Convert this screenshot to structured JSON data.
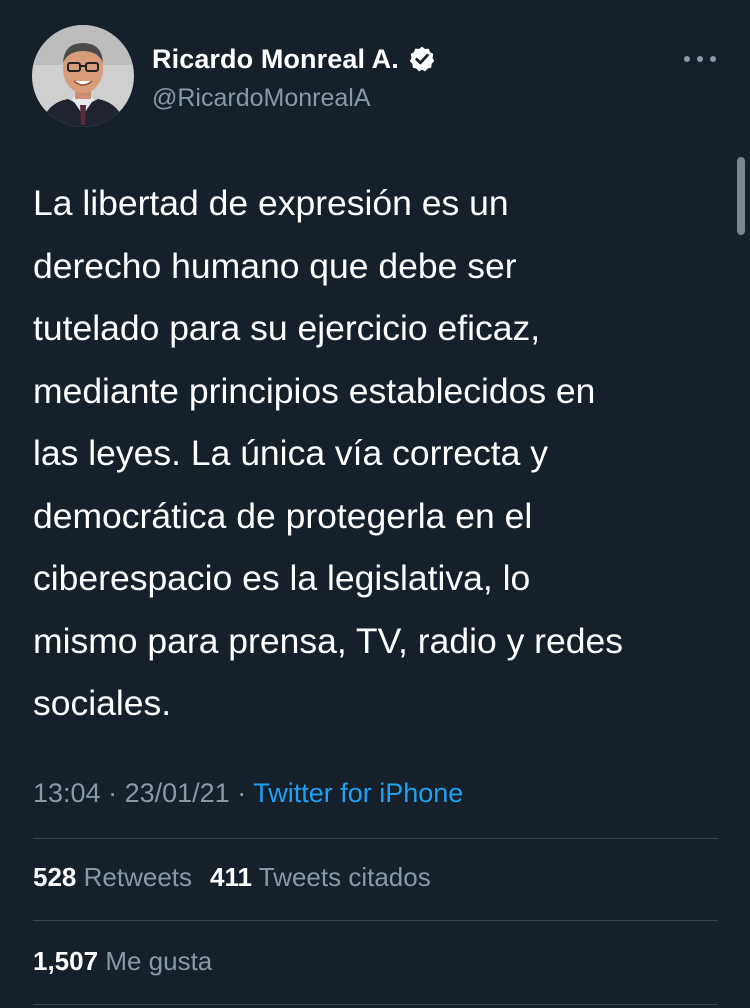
{
  "user": {
    "display_name": "Ricardo Monreal A.",
    "handle": "@RicardoMonrealA",
    "verified": true,
    "avatar_icon": "profile-photo"
  },
  "tweet": {
    "text": "La libertad de expresión es un\nderecho humano que debe ser\ntutelado para su ejercicio eficaz,\nmediante principios establecidos en\nlas leyes. La única vía correcta y\ndemocrática de protegerla en el\nciberespacio es la legislativa, lo\nmismo para prensa, TV, radio y redes\nsociales.",
    "time": "13:04",
    "date": "23/01/21",
    "separator": " · ",
    "source": "Twitter for iPhone"
  },
  "stats": {
    "retweets_count": "528",
    "retweets_label": "Retweets",
    "quotes_count": "411",
    "quotes_label": "Tweets citados",
    "likes_count": "1,507",
    "likes_label": "Me gusta"
  },
  "colors": {
    "background": "#15202b",
    "secondary_text": "#8899a6",
    "link": "#1da1f2",
    "divider": "#38444d"
  }
}
